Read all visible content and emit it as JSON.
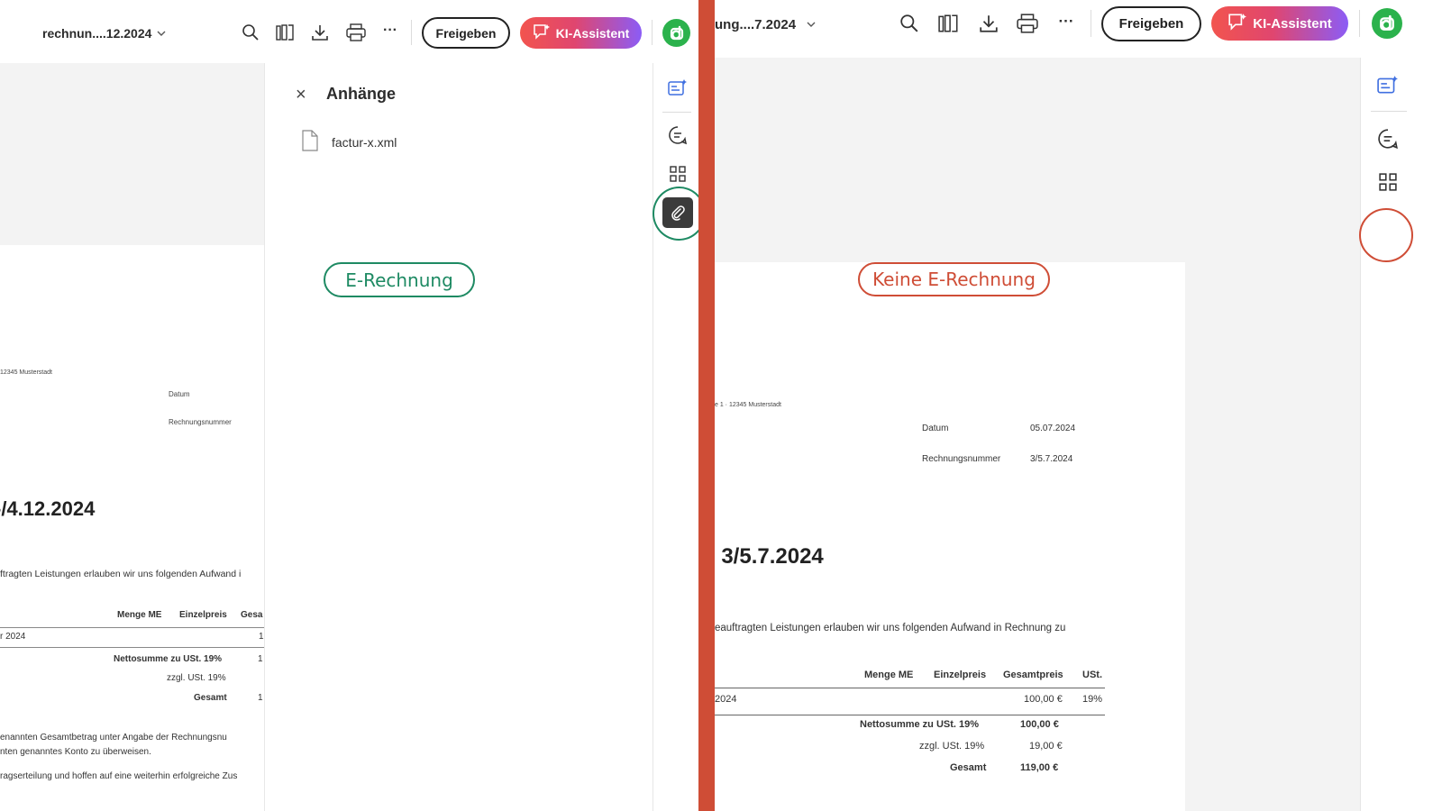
{
  "left": {
    "toolbar": {
      "filename": "rechnun....12.2024",
      "share_label": "Freigeben",
      "ai_label": "KI-Assistent",
      "more_label": "···"
    },
    "panel": {
      "title": "Anhänge",
      "close_label": "×",
      "attachments": [
        "factur-x.xml"
      ]
    },
    "annotation": "E-Rechnung",
    "document": {
      "sender_line": "12345 Musterstadt",
      "date_label": "Datum",
      "number_label": "Rechnungsnummer",
      "heading": "-/4.12.2024",
      "intro": "ftragten Leistungen erlauben wir uns folgenden Aufwand i",
      "col_qty": "Menge ME",
      "col_unit": "Einzelpreis",
      "col_total": "Gesa",
      "row_desc": "r 2024",
      "row_val": "1",
      "net_label": "Nettosumme zu USt. 19%",
      "net_val": "1",
      "vat_label": "zzgl. USt. 19%",
      "total_label": "Gesamt",
      "total_val": "1",
      "footer1": "enannten Gesamtbetrag unter Angabe der Rechnungsnu",
      "footer2": "nten genanntes Konto zu überweisen.",
      "footer3": "ragserteilung und hoffen auf eine weiterhin erfolgreiche Zus"
    }
  },
  "right": {
    "toolbar": {
      "filename": "ung....7.2024",
      "share_label": "Freigeben",
      "ai_label": "KI-Assistent",
      "more_label": "···"
    },
    "annotation": "Keine E-Rechnung",
    "document": {
      "sender_line": "e 1 · 12345 Musterstadt",
      "date_label": "Datum",
      "date_value": "05.07.2024",
      "number_label": "Rechnungsnummer",
      "number_value": "3/5.7.2024",
      "heading": "g 3/5.7.2024",
      "intro": "eauftragten Leistungen erlauben wir uns folgenden Aufwand in Rechnung zu",
      "col_qty": "Menge ME",
      "col_unit": "Einzelpreis",
      "col_total": "Gesamtpreis",
      "col_vat": "USt.",
      "row_desc": "2024",
      "row_total": "100,00 €",
      "row_vat": "19%",
      "net_label": "Nettosumme zu USt. 19%",
      "net_val": "100,00 €",
      "vat_label": "zzgl. USt. 19%",
      "vat_val": "19,00 €",
      "total_label": "Gesamt",
      "total_val": "119,00 €"
    }
  },
  "colors": {
    "divider": "#cf4d36",
    "e_invoice_green": "#1e8a63",
    "no_e_invoice_red": "#cf4d36",
    "rail_active": "#3b3b3b",
    "avatar": "#2bb24c"
  }
}
